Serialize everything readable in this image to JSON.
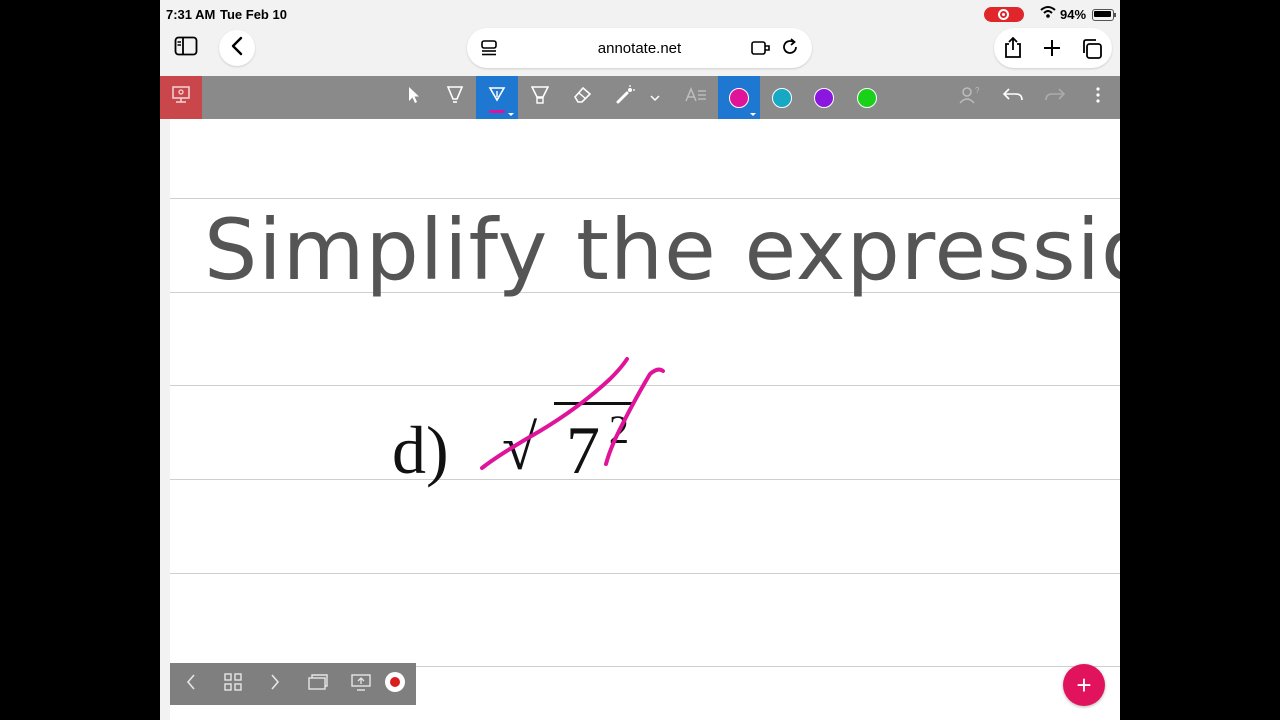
{
  "status_bar": {
    "time": "7:31 AM",
    "date": "Tue Feb 10",
    "battery": "94%"
  },
  "browser": {
    "url": "annotate.net"
  },
  "toolbar": {
    "tools": [
      "presenter-icon",
      "pointer-icon",
      "highlighter-icon",
      "pen-icon",
      "marker-icon",
      "eraser-icon",
      "laser-icon",
      "chevron-down-icon",
      "text-tool-icon"
    ],
    "active_tool": "pen-icon",
    "colors": [
      "#e0149a",
      "#17a8c4",
      "#8a16e0",
      "#1ad11a"
    ],
    "active_color": "#e0149a"
  },
  "page": {
    "heading": "Simplify the expression",
    "problem": {
      "label": "d)",
      "radical": "√",
      "base": "7",
      "exponent": "2"
    },
    "ink_color": "#e0149a"
  },
  "bottom_nav": {
    "icons": [
      "chevron-left-icon",
      "grid-icon",
      "chevron-right-icon",
      "pages-icon",
      "present-icon",
      "record-icon"
    ]
  },
  "fab": {
    "label": "+"
  }
}
